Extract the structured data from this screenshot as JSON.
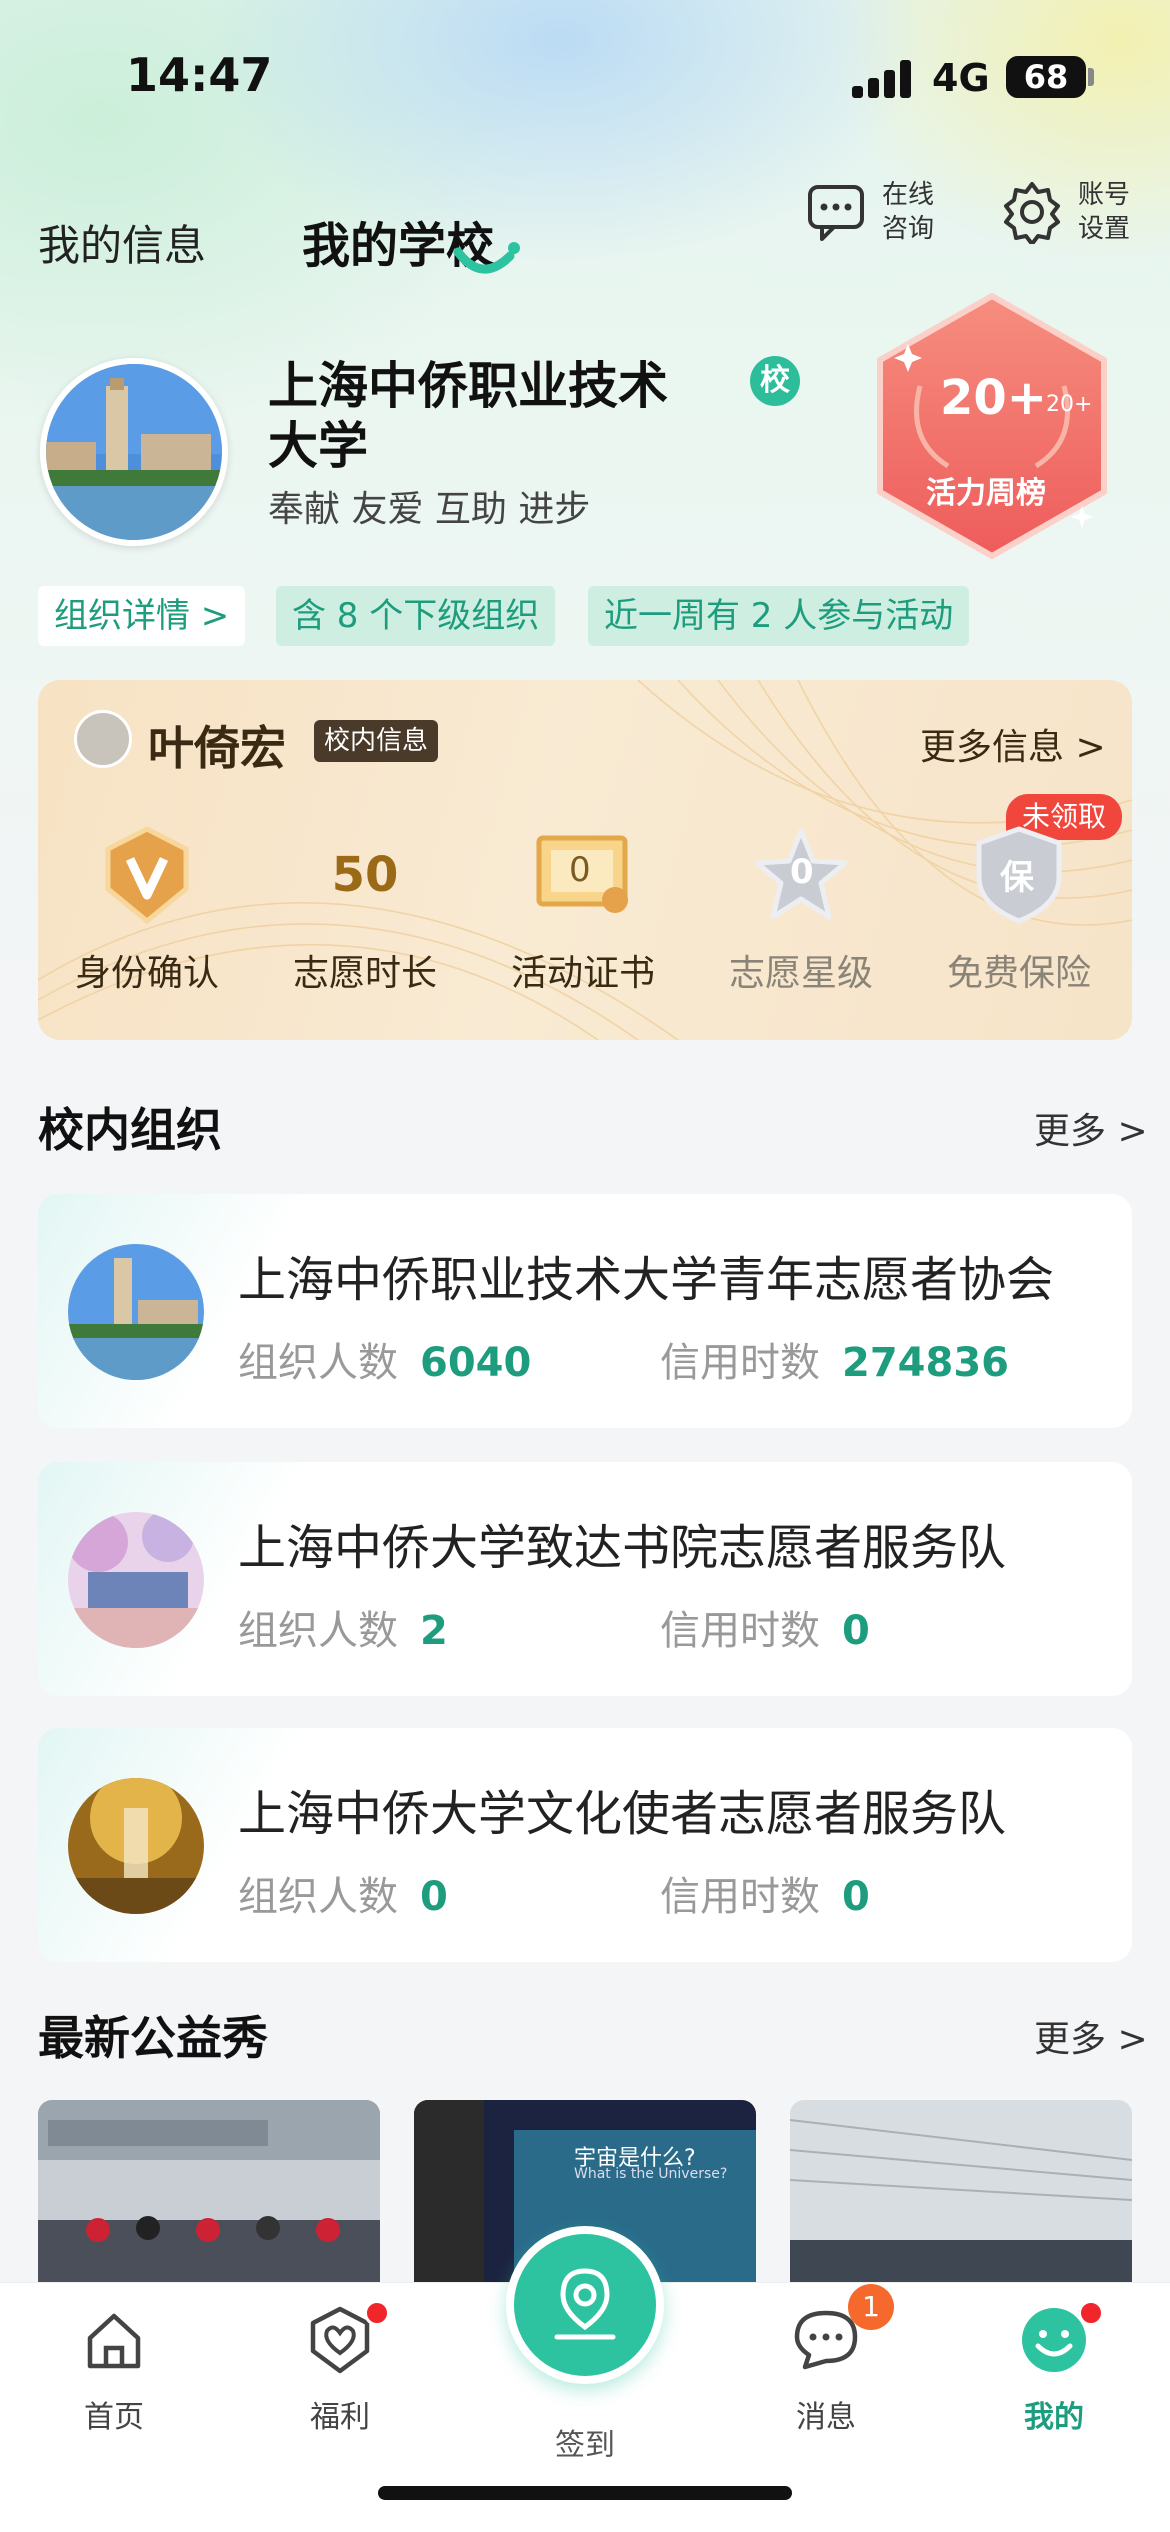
{
  "status": {
    "time": "14:47",
    "network": "4G",
    "battery": "68"
  },
  "tabs": {
    "my_info": "我的信息",
    "my_school": "我的学校"
  },
  "header": {
    "consult_line1": "在线",
    "consult_line2": "咨询",
    "settings_line1": "账号",
    "settings_line2": "设置"
  },
  "school": {
    "name": "上海中侨职业技术大学",
    "badge": "校",
    "motto": "奉献 友爱 互助 进步",
    "vitality_rank": "20+",
    "vitality_small": "20+",
    "vitality_label": "活力周榜",
    "chips": {
      "detail": "组织详情 >",
      "sub_orgs": "含 8 个下级组织",
      "week_active": "近一周有 2 人参与活动"
    }
  },
  "user": {
    "name": "叶倚宏",
    "tag": "校内信息",
    "more": "更多信息 >",
    "unclaimed": "未领取",
    "stats": [
      {
        "label": "身份确认",
        "icon": "V-badge-icon"
      },
      {
        "label": "志愿时长",
        "value": "50"
      },
      {
        "label": "活动证书",
        "value": "0",
        "icon": "certificate-icon"
      },
      {
        "label": "志愿星级",
        "value": "0",
        "icon": "star-badge-icon"
      },
      {
        "label": "免费保险",
        "value": "保",
        "icon": "insurance-shield-icon"
      }
    ]
  },
  "orgs": {
    "title": "校内组织",
    "more": "更多 >",
    "people_label": "组织人数",
    "hours_label": "信用时数",
    "items": [
      {
        "name": "上海中侨职业技术大学青年志愿者协会",
        "people": "6040",
        "hours": "274836"
      },
      {
        "name": "上海中侨大学致达书院志愿者服务队",
        "people": "2",
        "hours": "0"
      },
      {
        "name": "上海中侨大学文化使者志愿者服务队",
        "people": "0",
        "hours": "0"
      }
    ]
  },
  "shows": {
    "title": "最新公益秀",
    "more": "更多 >",
    "img2_text": "宇宙是什么?",
    "img2_sub": "What is the Universe?"
  },
  "tabbar": {
    "home": "首页",
    "welfare": "福利",
    "checkin": "签到",
    "messages": "消息",
    "messages_badge": "1",
    "mine": "我的"
  },
  "colors": {
    "accent": "#2ec3a0",
    "accent_text": "#1e9d7e",
    "vitality": "#f06e6a"
  }
}
